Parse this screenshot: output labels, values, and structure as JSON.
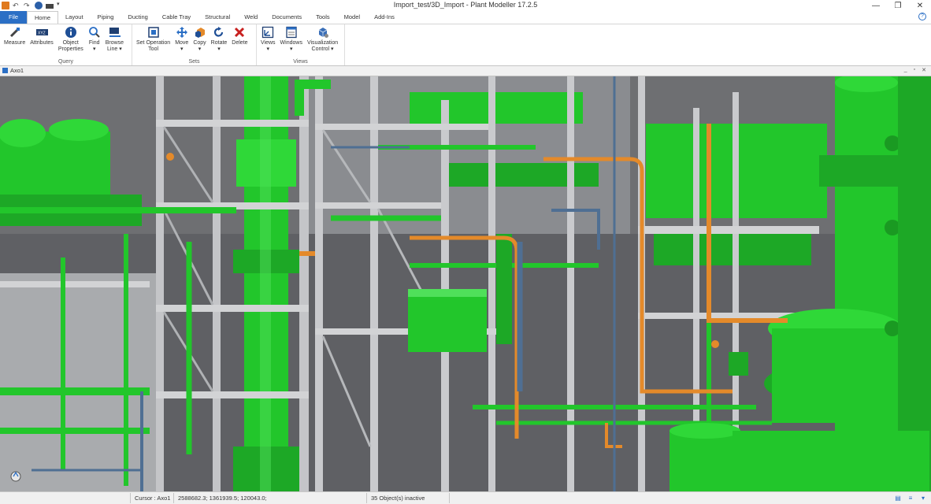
{
  "window": {
    "title": "Import_test/3D_Import - Plant Modeller 17.2.5",
    "controls": {
      "minimize": "—",
      "restore": "❐",
      "close": "✕"
    }
  },
  "ribbon": {
    "tabs": [
      {
        "label": "File"
      },
      {
        "label": "Home"
      },
      {
        "label": "Layout"
      },
      {
        "label": "Piping"
      },
      {
        "label": "Ducting"
      },
      {
        "label": "Cable Tray"
      },
      {
        "label": "Structural"
      },
      {
        "label": "Weld"
      },
      {
        "label": "Documents"
      },
      {
        "label": "Tools"
      },
      {
        "label": "Model"
      },
      {
        "label": "Add-Ins"
      }
    ],
    "active_tab": "Home",
    "help_label": "?",
    "groups": {
      "query": {
        "label": "Query",
        "buttons": {
          "measure": "Measure",
          "attributes": "Attributes",
          "object_properties_1": "Object",
          "object_properties_2": "Properties",
          "find_1": "Find",
          "find_2": "▾",
          "browse_line_1": "Browse",
          "browse_line_2": "Line ▾"
        }
      },
      "sets": {
        "label": "Sets",
        "buttons": {
          "set_operation_1": "Set Operation",
          "set_operation_2": "Tool",
          "move_1": "Move",
          "move_2": "▾",
          "copy_1": "Copy",
          "copy_2": "▾",
          "rotate_1": "Rotate",
          "rotate_2": "▾",
          "delete": "Delete"
        }
      },
      "views": {
        "label": "Views",
        "buttons": {
          "views_1": "Views",
          "views_2": "▾",
          "windows_1": "Windows",
          "windows_2": "▾",
          "visualization_1": "Visualization",
          "visualization_2": "Control ▾"
        }
      }
    }
  },
  "document": {
    "tab_label": "Axo1",
    "controls": {
      "minimize": "_",
      "restore": "▫",
      "close": "✕"
    }
  },
  "statusbar": {
    "cursor": "Cursor : Axo1",
    "coordinates": "2588682.3; 1361939.5; 120043.0;",
    "objects": "35 Object(s) inactive"
  },
  "colors": {
    "equipment_green": "#22c62b",
    "steel_grey": "#b9bbbe",
    "pipe_orange": "#e48a2a",
    "pipe_blue": "#4f6f93",
    "background": "#6e6f72"
  }
}
